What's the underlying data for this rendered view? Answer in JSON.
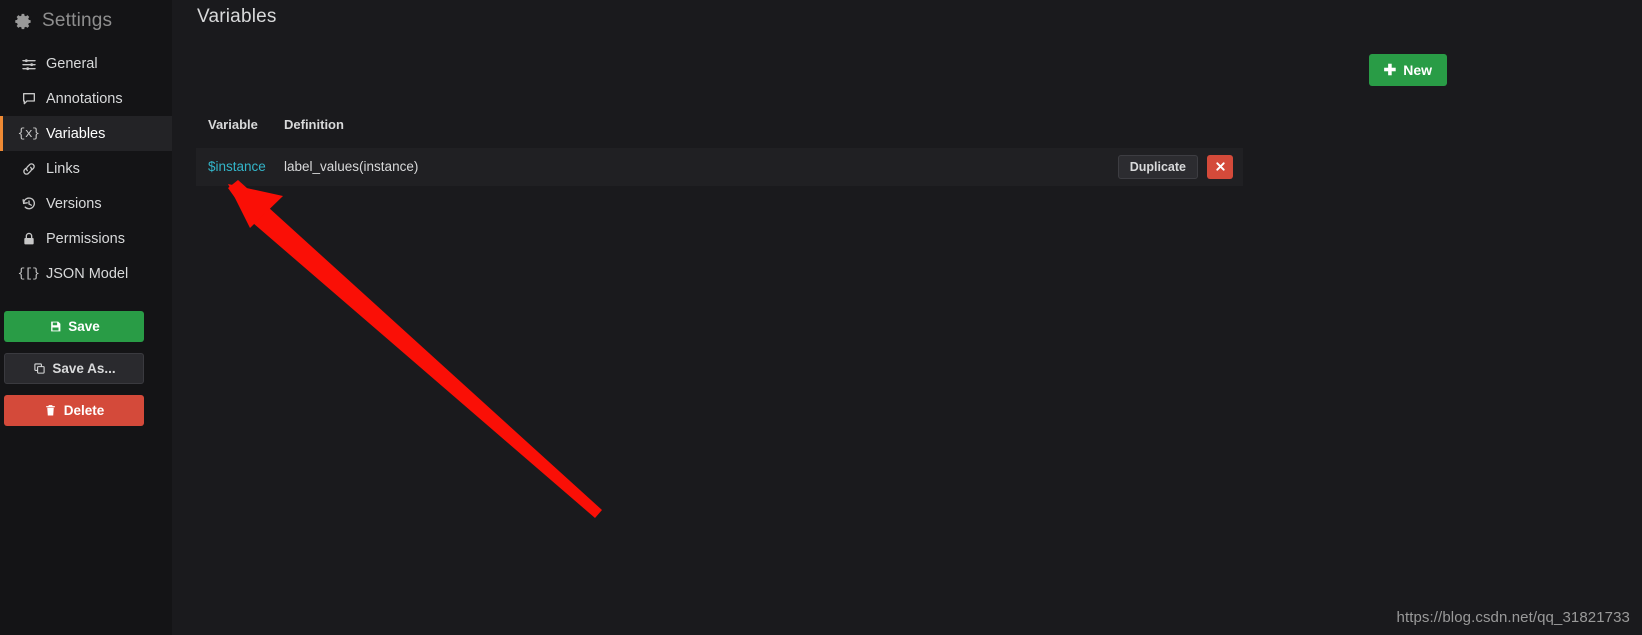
{
  "sidebar": {
    "header": {
      "title": "Settings",
      "icon": "gear-icon"
    },
    "items": [
      {
        "label": "General",
        "icon": "sliders-icon",
        "active": false
      },
      {
        "label": "Annotations",
        "icon": "comment-icon",
        "active": false
      },
      {
        "label": "Variables",
        "icon": "curly-braces-x-icon",
        "active": true
      },
      {
        "label": "Links",
        "icon": "link-icon",
        "active": false
      },
      {
        "label": "Versions",
        "icon": "history-icon",
        "active": false
      },
      {
        "label": "Permissions",
        "icon": "lock-icon",
        "active": false
      },
      {
        "label": "JSON Model",
        "icon": "json-brackets-icon",
        "active": false
      }
    ],
    "actions": [
      {
        "label": "Save",
        "icon": "save-disk-icon",
        "style": "primary"
      },
      {
        "label": "Save As...",
        "icon": "copy-icon",
        "style": "secondary"
      },
      {
        "label": "Delete",
        "icon": "trash-icon",
        "style": "danger"
      }
    ]
  },
  "main": {
    "title": "Variables",
    "new_button": {
      "label": "New",
      "icon": "plus-icon"
    },
    "table": {
      "headers": {
        "variable": "Variable",
        "definition": "Definition"
      },
      "rows": [
        {
          "variable": "$instance",
          "definition": "label_values(instance)",
          "duplicate_label": "Duplicate",
          "delete_icon": "close-x-icon"
        }
      ]
    }
  },
  "watermark": "https://blog.csdn.net/qq_31821733",
  "colors": {
    "accent_orange": "#ef8a34",
    "green": "#299c46",
    "red": "#d44a3a",
    "link_teal": "#33b5c9",
    "sidebar_bg": "#141416",
    "content_bg": "#1a1a1d",
    "row_bg": "#202023",
    "annotation_red": "#fa0f06"
  }
}
